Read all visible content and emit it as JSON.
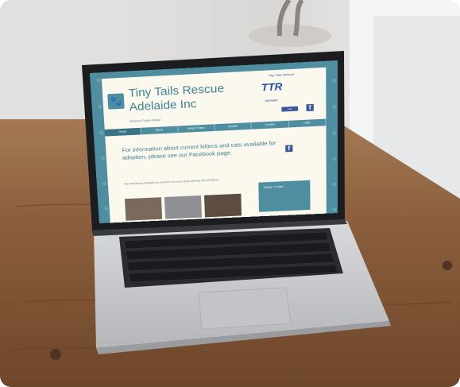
{
  "website": {
    "logo_icon": "paw-icon",
    "title_line1": "Tiny Tails Rescue",
    "title_line2": "Adelaide Inc",
    "tagline": "Rescue Foster Adopt",
    "partner_logo": {
      "top_text": "Tiny Tails Rescue",
      "initials": "TTR",
      "bottom_text": "Adelaide"
    },
    "like_button": "Like",
    "facebook_icon": "facebook-icon",
    "nav": [
      "Home",
      "About",
      "Adopt / Foster",
      "Donate",
      "Contact",
      "Links"
    ],
    "intro": "For information about current kittens and cats available for adoption, please see our Facebook page.",
    "body_text": "Tiny Tails Rescue Adelaide is a volunteer run rescue group rescuing cats and kittens.",
    "sidebar_text": "Adopt / Foster"
  },
  "colors": {
    "site_teal": "#4f8ea0",
    "page_cream": "#fbf8ee",
    "desk_wood": "#8a5e3c",
    "laptop_silver": "#c9cbce",
    "keys_black": "#1d1e21"
  }
}
